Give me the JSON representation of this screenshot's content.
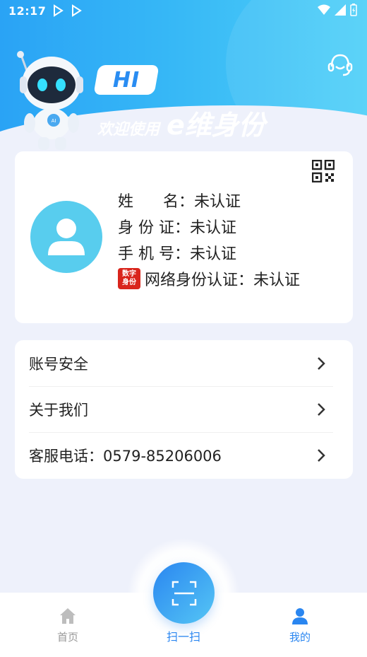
{
  "status_bar": {
    "time": "12:17"
  },
  "header": {
    "hi_text": "HI",
    "welcome_text": "欢迎使用",
    "brand_text": "e维身份",
    "support_icon": "customer-service-headset-icon"
  },
  "profile": {
    "qr_icon": "qr-code-icon",
    "avatar_icon": "user-avatar-icon",
    "name_label": "姓      名：",
    "name_value": "未认证",
    "id_label": "身 份 证：",
    "id_value": "未认证",
    "phone_label": "手 机 号：",
    "phone_value": "未认证",
    "digital_badge_line1": "数字",
    "digital_badge_line2": "身份",
    "network_label": "网络身份认证：",
    "network_value": "未认证"
  },
  "menu": {
    "items": [
      {
        "label": "账号安全"
      },
      {
        "label": "关于我们"
      },
      {
        "label": "客服电话：0579-85206006"
      }
    ]
  },
  "bottom_nav": {
    "home": "首页",
    "scan": "扫一扫",
    "mine": "我的"
  },
  "colors": {
    "primary": "#2a86f0",
    "avatar_bg": "#58cdee",
    "badge_red": "#d9251c",
    "inactive": "#999999"
  }
}
